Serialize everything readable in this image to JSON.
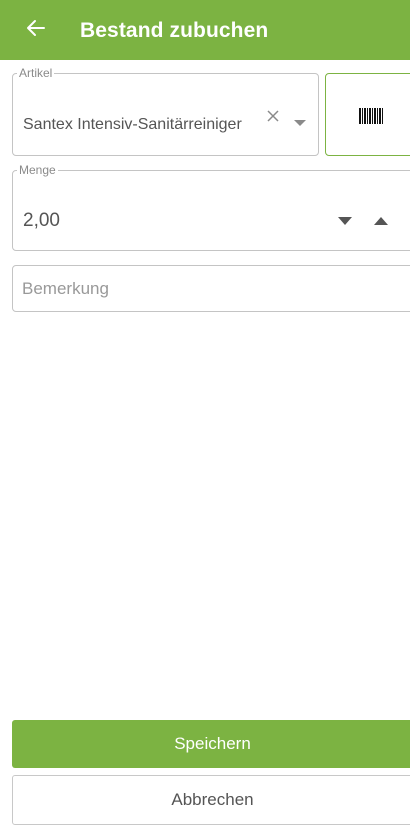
{
  "header": {
    "title": "Bestand zubuchen",
    "back_icon": "arrow-left-icon",
    "background": "#7cb342"
  },
  "artikel": {
    "label": "Artikel",
    "value": "Santex Intensiv-Sanitärreiniger",
    "clear_icon": "close-icon",
    "dropdown_icon": "caret-down-icon"
  },
  "barcode": {
    "icon": "barcode-icon"
  },
  "menge": {
    "label": "Menge",
    "value": "2,00",
    "decrement_icon": "caret-down-icon",
    "increment_icon": "caret-up-icon"
  },
  "bemerkung": {
    "placeholder": "Bemerkung",
    "value": ""
  },
  "actions": {
    "save_label": "Speichern",
    "cancel_label": "Abbrechen",
    "accent": "#7cb342"
  }
}
